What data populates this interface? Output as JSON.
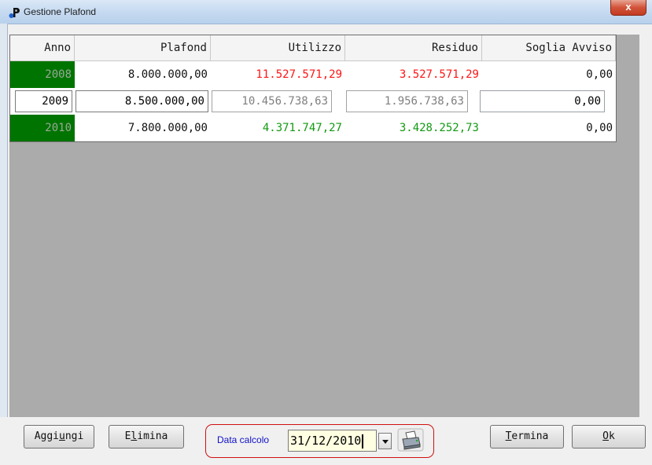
{
  "window": {
    "title": "Gestione Plafond",
    "close_label": "x"
  },
  "table": {
    "columns": [
      "Anno",
      "Plafond",
      "Utilizzo",
      "Residuo",
      "Soglia Avviso"
    ],
    "rows": [
      {
        "anno": "2008",
        "plafond": "8.000.000,00",
        "utilizzo": "11.527.571,29",
        "residuo": "3.527.571,29",
        "soglia": "0,00"
      },
      {
        "anno": "2009",
        "plafond": "8.500.000,00",
        "utilizzo": "10.456.738,63",
        "residuo": "1.956.738,63",
        "soglia": "0,00"
      },
      {
        "anno": "2010",
        "plafond": "7.800.000,00",
        "utilizzo": "4.371.747,27",
        "residuo": "3.428.252,73",
        "soglia": "0,00"
      }
    ]
  },
  "toolbar": {
    "add_pre": "Aggi",
    "add_hot": "u",
    "add_post": "ngi",
    "delete_pre": "E",
    "delete_hot": "l",
    "delete_post": "imina",
    "calc_label": "Data calcolo",
    "calc_date": "31/12/2010",
    "end_hot": "T",
    "end_post": "ermina",
    "ok_hot": "O",
    "ok_post": "k"
  },
  "colors": {
    "over_limit": "#ff1414",
    "under_limit": "#119a11",
    "year_highlight": "#007400",
    "calc_border": "#d01010",
    "calc_label": "#1010c8"
  },
  "icons": {
    "app": "app-logo-icon",
    "print": "printer-icon",
    "dropdown": "chevron-down-icon"
  }
}
